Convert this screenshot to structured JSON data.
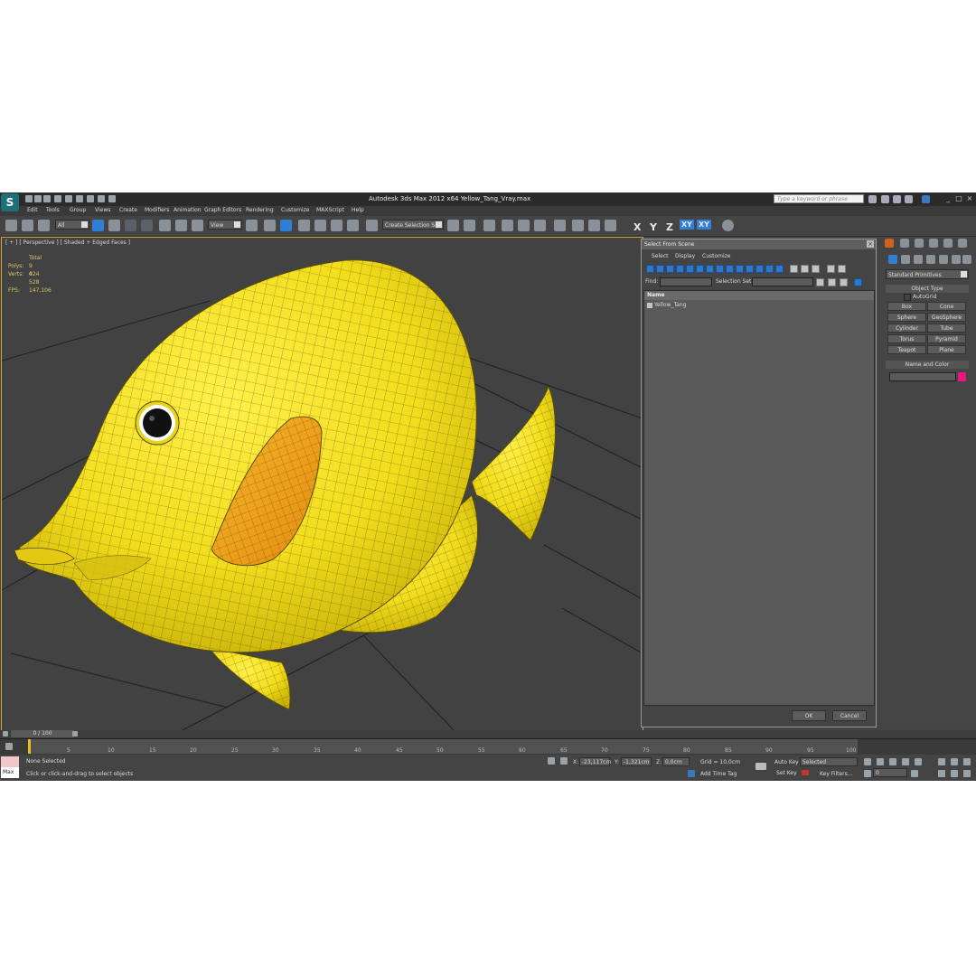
{
  "titlebar": {
    "title": "Autodesk 3ds Max  2012 x64      Yellow_Tang_Vray.max",
    "search_placeholder": "Type a keyword or phrase"
  },
  "menu": [
    "Edit",
    "Tools",
    "Group",
    "Views",
    "Create",
    "Modifiers",
    "Animation",
    "Graph Editors",
    "Rendering",
    "Customize",
    "MAXScript",
    "Help"
  ],
  "toolbar": {
    "filter": "All",
    "ref_coord": "View",
    "selection_set": "Create Selection Se",
    "axis_labels": [
      "X",
      "Y",
      "Z",
      "XY",
      "XY"
    ]
  },
  "viewport": {
    "label": "[ + ] [ Perspective ] [ Shaded + Edged Faces ]",
    "stats": {
      "total_label": "Total",
      "polys_label": "Polys:",
      "polys_value": "9 024",
      "verts_label": "Verts:",
      "verts_value": "4 528",
      "fps_label": "FPS:",
      "fps_value": "147,106"
    }
  },
  "dialog": {
    "title": "Select From Scene",
    "menu": [
      "Select",
      "Display",
      "Customize"
    ],
    "find_label": "Find:",
    "selection_set_label": "Selection Set:",
    "column_name": "Name",
    "items": [
      "Yellow_Tang"
    ],
    "ok": "OK",
    "cancel": "Cancel"
  },
  "command_panel": {
    "category": "Standard Primitives",
    "object_type_header": "Object Type",
    "autogrid": "AutoGrid",
    "buttons": [
      "Box",
      "Cone",
      "Sphere",
      "GeoSphere",
      "Cylinder",
      "Tube",
      "Torus",
      "Pyramid",
      "Teapot",
      "Plane"
    ],
    "name_color_header": "Name and Color",
    "color": "#e8177f"
  },
  "timeline": {
    "frame_counter": "0 / 100",
    "ticks": [
      "5",
      "10",
      "15",
      "20",
      "25",
      "30",
      "35",
      "40",
      "45",
      "50",
      "55",
      "60",
      "65",
      "70",
      "75",
      "80",
      "85",
      "90",
      "95",
      "100"
    ]
  },
  "status": {
    "maxscript": "Max",
    "selection": "None Selected",
    "prompt": "Click or click-and-drag to select objects",
    "x_label": "X:",
    "x_value": "-23,117cm",
    "y_label": "Y:",
    "y_value": "-1,321cm",
    "z_label": "Z:",
    "z_value": "0,0cm",
    "grid": "Grid = 10,0cm",
    "add_time_tag": "Add Time Tag",
    "auto_key": "Auto Key",
    "set_key": "Set Key",
    "key_mode": "Selected",
    "key_filters": "Key Filters...",
    "frame": "0"
  },
  "colors": {
    "fish": "#f2dc1c",
    "fish_shadow": "#c9b20a",
    "fin_orange": "#f0a422",
    "viewport_bg": "#424242",
    "active_border": "#d4a53a"
  }
}
